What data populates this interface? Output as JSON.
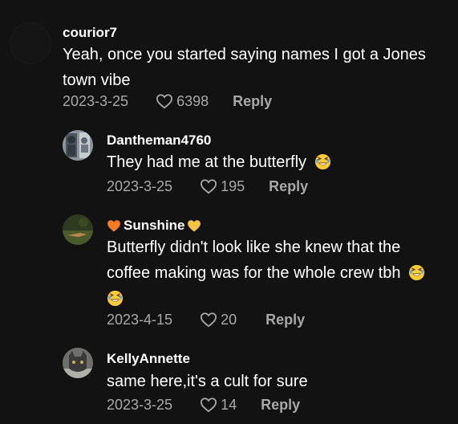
{
  "comments": [
    {
      "username": "courior7",
      "text_lines": [
        "Yeah, once you started saying names I got a Jones",
        "town vibe"
      ],
      "date": "2023-3-25",
      "likes": "6398",
      "reply_label": "Reply"
    },
    {
      "username": "Dantheman4760",
      "text_lines": [
        "They had me at the butterfly"
      ],
      "date": "2023-3-25",
      "likes": "195",
      "reply_label": "Reply",
      "emoji": "laughing-emoji"
    },
    {
      "username": "Sunshine",
      "text_lines": [
        "Butterfly didn't look like she knew that the",
        "coffee making was for the whole crew tbh"
      ],
      "date": "2023-4-15",
      "likes": "20",
      "reply_label": "Reply",
      "emoji": "laughing-emoji",
      "name_icons": [
        "orange-heart-icon",
        "yellow-heart-icon"
      ]
    },
    {
      "username": "KellyAnnette",
      "text_lines": [
        "same here,it's a cult for sure"
      ],
      "date": "2023-3-25",
      "likes": "14",
      "reply_label": "Reply"
    }
  ],
  "colors": {
    "background": "#121212",
    "text": "#ffffff",
    "secondary": "#a8a8a8",
    "orange_heart": "#f57c23",
    "yellow_heart": "#f5c542",
    "emoji_face": "#ffcc33"
  }
}
